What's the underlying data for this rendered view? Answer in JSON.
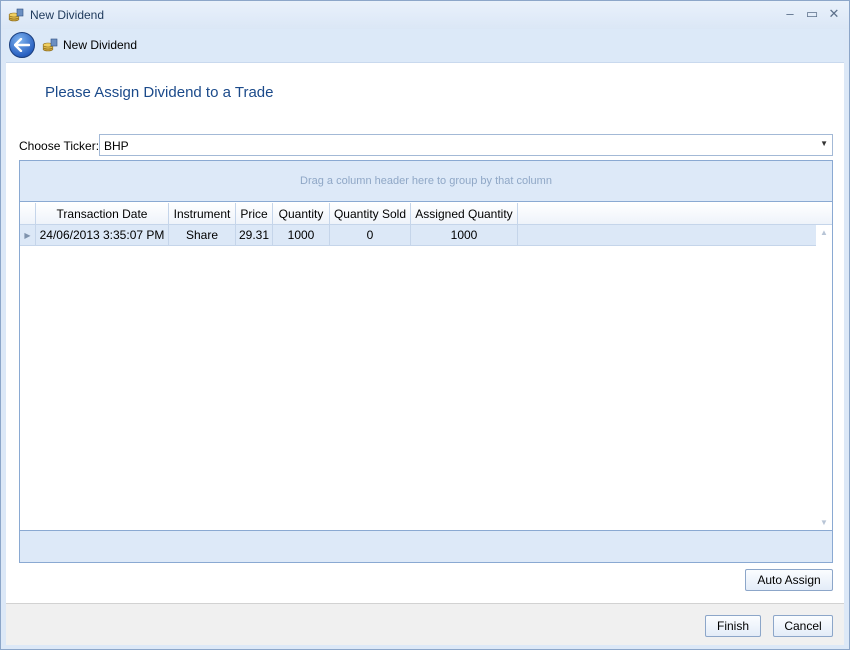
{
  "window": {
    "title": "New Dividend",
    "controls": [
      "minimize",
      "maximize",
      "close"
    ]
  },
  "nav": {
    "back_icon": "back-arrow-icon",
    "title": "New Dividend"
  },
  "page": {
    "heading": "Please Assign Dividend to a Trade",
    "ticker_label": "Choose Ticker:",
    "ticker_value": "BHP"
  },
  "grid": {
    "group_hint": "Drag a column header here to group by that column",
    "columns": [
      "Transaction Date",
      "Instrument",
      "Price",
      "Quantity",
      "Quantity Sold",
      "Assigned Quantity"
    ],
    "rows": [
      [
        "24/06/2013 3:35:07 PM",
        "Share",
        "29.31",
        "1000",
        "0",
        "1000"
      ]
    ]
  },
  "buttons": {
    "auto_assign": "Auto Assign",
    "finish": "Finish",
    "cancel": "Cancel"
  },
  "colors": {
    "heading": "#1b4a8a",
    "window_bg": "#dce8f7",
    "selected_row": "#dce8f7"
  }
}
